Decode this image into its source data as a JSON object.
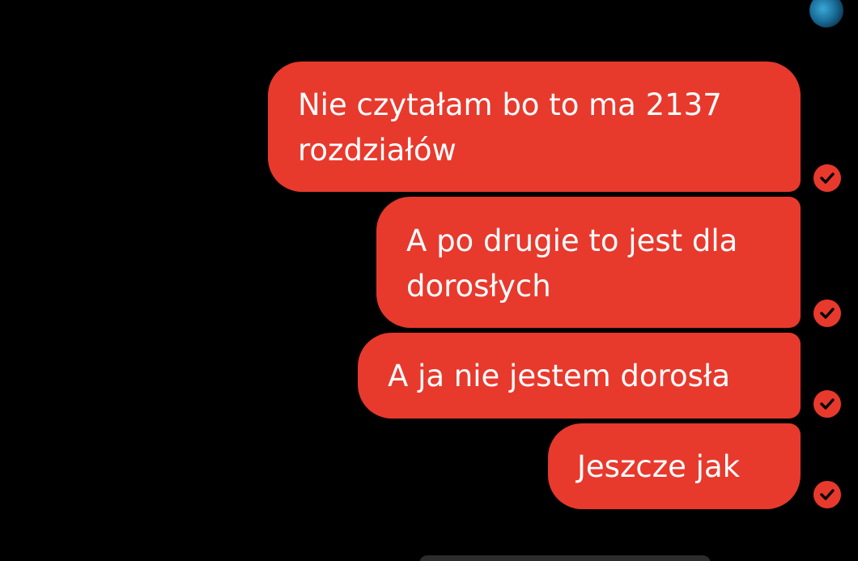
{
  "conversation": {
    "messages": [
      {
        "text": "Nie czytałam bo to ma 2137 rozdziałów",
        "lines": [
          "Nie czytałam bo to ma 2137",
          "rozdziałów"
        ],
        "status": "check-icon"
      },
      {
        "text": "A po drugie to jest dla dorosłych",
        "lines": [
          "A po drugie to jest dla",
          "dorosłych"
        ],
        "status": "check-icon"
      },
      {
        "text": "A ja nie jestem dorosła",
        "lines": [
          "A ja nie jestem dorosła"
        ],
        "status": "check-icon"
      },
      {
        "text": "Jeszcze jak",
        "lines": [
          "Jeszcze jak"
        ],
        "status": "check-icon"
      }
    ]
  },
  "colors": {
    "background": "#000000",
    "bubble": "#e8392d",
    "text": "#ffffff"
  },
  "icons": [
    "avatar",
    "check-icon"
  ]
}
